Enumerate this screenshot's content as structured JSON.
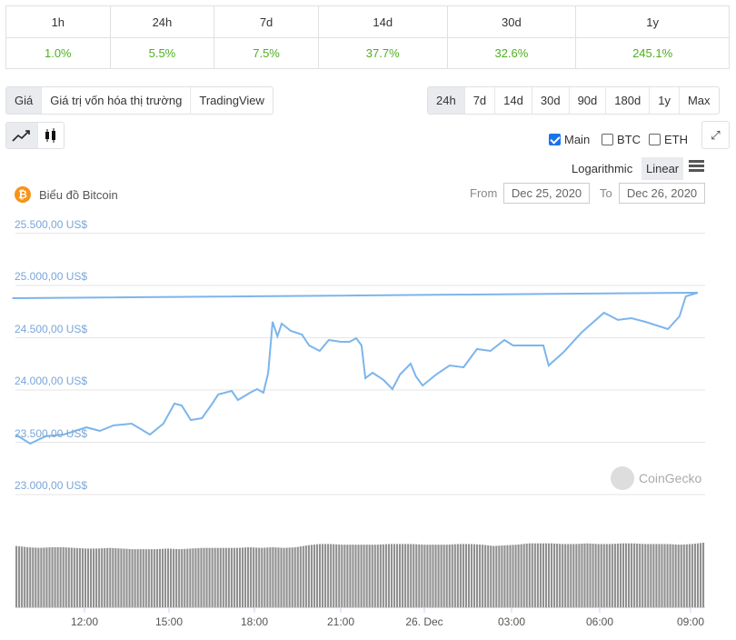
{
  "performance": {
    "headers": [
      "1h",
      "24h",
      "7d",
      "14d",
      "30d",
      "1y"
    ],
    "values": [
      "1.0%",
      "5.5%",
      "7.5%",
      "37.7%",
      "32.6%",
      "245.1%"
    ],
    "color": "#4eb01e"
  },
  "chart_tabs": [
    "Giá",
    "Giá trị vốn hóa thị trường",
    "TradingView"
  ],
  "chart_tabs_active": "Giá",
  "ranges": [
    "24h",
    "7d",
    "14d",
    "30d",
    "90d",
    "180d",
    "1y",
    "Max"
  ],
  "range_active": "24h",
  "chart_types": {
    "line": "line-chart-icon",
    "candle": "candlestick-icon",
    "active": "line"
  },
  "compare": [
    {
      "label": "Main",
      "checked": true
    },
    {
      "label": "BTC",
      "checked": false
    },
    {
      "label": "ETH",
      "checked": false
    }
  ],
  "scale": {
    "log": "Logarithmic",
    "linear": "Linear",
    "active": "Linear"
  },
  "title": "Biểu đồ Bitcoin",
  "from_label": "From",
  "from": "Dec 25, 2020",
  "to_label": "To",
  "to": "Dec 26, 2020",
  "watermark": "CoinGecko",
  "chart_data": {
    "type": "line",
    "line_color": "#7cb5ec",
    "volume_color": "#909090",
    "y_ticks": [
      "25.500,00 US$",
      "25.000,00 US$",
      "24.500,00 US$",
      "24.000,00 US$",
      "23.500,00 US$",
      "23.000,00 US$"
    ],
    "ylim": [
      23000,
      25500
    ],
    "x_ticks": [
      "12:00",
      "15:00",
      "18:00",
      "21:00",
      "26. Dec",
      "03:00",
      "06:00",
      "09:00"
    ],
    "grid": true,
    "price": [
      [
        "09:37",
        23574
      ],
      [
        "10:07",
        23487
      ],
      [
        "10:39",
        23557
      ],
      [
        "11:17",
        23574
      ],
      [
        "12:04",
        23643
      ],
      [
        "12:32",
        23609
      ],
      [
        "13:00",
        23661
      ],
      [
        "13:38",
        23678
      ],
      [
        "14:16",
        23574
      ],
      [
        "14:44",
        23678
      ],
      [
        "15:07",
        23870
      ],
      [
        "15:22",
        23852
      ],
      [
        "15:41",
        23713
      ],
      [
        "16:04",
        23730
      ],
      [
        "16:23",
        23852
      ],
      [
        "16:38",
        23957
      ],
      [
        "17:06",
        23991
      ],
      [
        "17:19",
        23904
      ],
      [
        "17:44",
        23974
      ],
      [
        "17:59",
        24009
      ],
      [
        "18:12",
        23974
      ],
      [
        "18:22",
        24165
      ],
      [
        "18:31",
        24652
      ],
      [
        "18:41",
        24513
      ],
      [
        "18:50",
        24635
      ],
      [
        "19:09",
        24565
      ],
      [
        "19:32",
        24530
      ],
      [
        "19:47",
        24426
      ],
      [
        "20:09",
        24374
      ],
      [
        "20:28",
        24478
      ],
      [
        "20:53",
        24461
      ],
      [
        "21:11",
        24461
      ],
      [
        "21:25",
        24496
      ],
      [
        "21:36",
        24426
      ],
      [
        "21:44",
        24113
      ],
      [
        "21:59",
        24165
      ],
      [
        "22:22",
        24096
      ],
      [
        "22:40",
        24009
      ],
      [
        "22:56",
        24148
      ],
      [
        "23:18",
        24252
      ],
      [
        "23:29",
        24130
      ],
      [
        "23:43",
        24043
      ],
      [
        "00:11",
        24148
      ],
      [
        "00:39",
        24235
      ],
      [
        "01:08",
        24217
      ],
      [
        "01:36",
        24391
      ],
      [
        "02:04",
        24374
      ],
      [
        "02:33",
        24478
      ],
      [
        "02:51",
        24426
      ],
      [
        "03:20",
        24426
      ],
      [
        "03:54",
        24426
      ],
      [
        "04:05",
        24235
      ],
      [
        "04:35",
        24357
      ],
      [
        "05:13",
        24548
      ],
      [
        "06:00",
        24739
      ],
      [
        "06:29",
        24670
      ],
      [
        "06:57",
        24687
      ],
      [
        "07:26",
        24652
      ],
      [
        "08:13",
        24583
      ],
      [
        "08:37",
        24704
      ],
      [
        "08:50",
        24896
      ],
      [
        "09:15",
        24930
      ],
      [
        "09:30",
        24878
      ]
    ],
    "volume_relative": [
      0.95,
      0.93,
      0.92,
      0.93,
      0.93,
      0.92,
      0.91,
      0.91,
      0.92,
      0.91,
      0.9,
      0.9,
      0.9,
      0.91,
      0.9,
      0.91,
      0.92,
      0.92,
      0.92,
      0.92,
      0.93,
      0.92,
      0.93,
      0.92,
      0.93,
      0.96,
      0.98,
      0.98,
      0.97,
      0.97,
      0.97,
      0.97,
      0.98,
      0.98,
      0.98,
      0.97,
      0.97,
      0.97,
      0.98,
      0.98,
      0.97,
      0.95,
      0.96,
      0.97,
      0.99,
      0.99,
      0.99,
      0.98,
      0.98,
      0.99,
      0.98,
      0.98,
      0.99,
      0.99,
      0.98,
      0.98,
      0.98,
      0.97,
      0.98,
      1.0
    ]
  }
}
